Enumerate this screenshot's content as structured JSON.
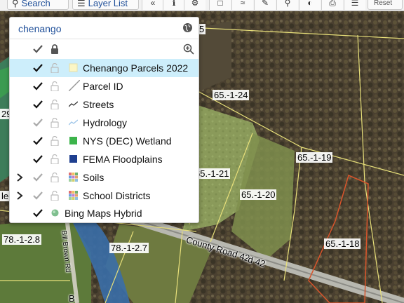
{
  "toolbar": {
    "search_label": "Search",
    "layer_list_label": "Layer List",
    "reset_label": "Reset",
    "icons": [
      "collapse-icon",
      "info-icon",
      "tool-icon",
      "select-icon",
      "measure-icon",
      "draw-icon",
      "zoom-icon",
      "basemap-icon",
      "print-icon",
      "menu-icon"
    ]
  },
  "layer_panel": {
    "search_text": "chenango",
    "layers": [
      {
        "label": "Chenango Parcels 2022",
        "checked": true,
        "symbol": "pale-yellow-square",
        "expandable": false,
        "selected": true
      },
      {
        "label": "Parcel ID",
        "checked": true,
        "symbol": "gray-diagonal-line",
        "expandable": false,
        "selected": false
      },
      {
        "label": "Streets",
        "checked": true,
        "symbol": "dark-line",
        "expandable": false,
        "selected": false
      },
      {
        "label": "Hydrology",
        "checked": false,
        "symbol": "light-blue-line",
        "expandable": false,
        "selected": false
      },
      {
        "label": "NYS (DEC) Wetland",
        "checked": true,
        "symbol": "green-square",
        "expandable": false,
        "selected": false
      },
      {
        "label": "FEMA Floodplains",
        "checked": true,
        "symbol": "navy-square",
        "expandable": false,
        "selected": false
      },
      {
        "label": "Soils",
        "checked": false,
        "symbol": "multicolor-grid",
        "expandable": true,
        "selected": false
      },
      {
        "label": "School Districts",
        "checked": false,
        "symbol": "multicolor-grid",
        "expandable": true,
        "selected": false
      },
      {
        "label": "Bing Maps Hybrid",
        "checked": true,
        "symbol": "basemap-globe",
        "expandable": false,
        "selected": false
      }
    ]
  },
  "map": {
    "parcel_labels": [
      "65.-1-24",
      "65.-1-19",
      "65.-1-21",
      "65.-1-20",
      "65.-1-18",
      "78.-1-2.8",
      "78.-1-2.7",
      "29",
      "le-",
      "5"
    ],
    "road_labels": [
      "County Road 42",
      "d 42",
      "Bill Brown Rd",
      "B"
    ]
  },
  "colors": {
    "link": "#1f4f99",
    "selected_row": "#cdeefb",
    "parcel_line": "#e8e07a",
    "highlight_parcel": "#d9542b",
    "wetland": "#3cb44b",
    "floodplain": "#1f3f8f"
  }
}
